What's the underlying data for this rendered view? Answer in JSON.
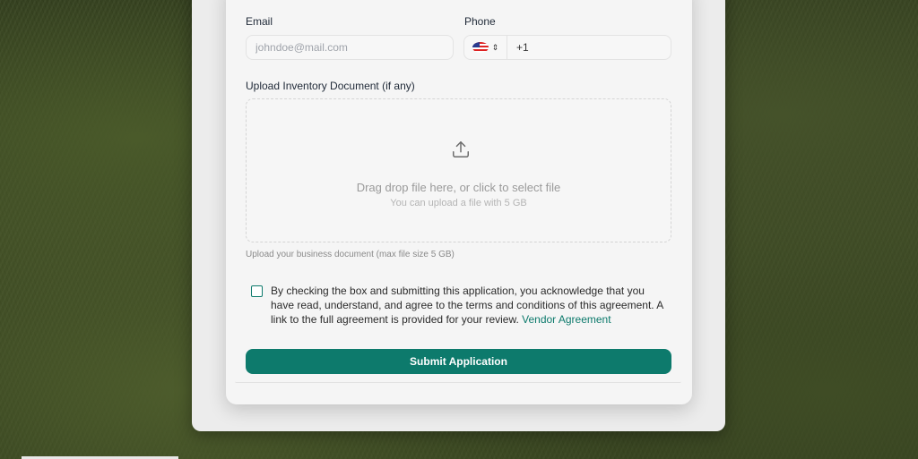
{
  "form": {
    "email_label": "Email",
    "email_placeholder": "johndoe@mail.com",
    "phone_label": "Phone",
    "phone_country_code": "+1",
    "phone_country_flag_icon": "us-flag-icon",
    "upload_label": "Upload Inventory Document (if any)",
    "dropzone_title": "Drag drop file here, or click to select file",
    "dropzone_subtitle": "You can upload a file with 5 GB",
    "upload_helper": "Upload your business document (max file size 5 GB)",
    "agreement_text": "By checking the box and submitting this application, you acknowledge that you have read, understand, and agree to the terms and conditions of this agreement. A link to the full agreement is provided for your review. ",
    "agreement_link": "Vendor Agreement",
    "submit_label": "Submit Application"
  },
  "colors": {
    "accent": "#0d7a6c",
    "card_background": "#f5f5f5"
  }
}
